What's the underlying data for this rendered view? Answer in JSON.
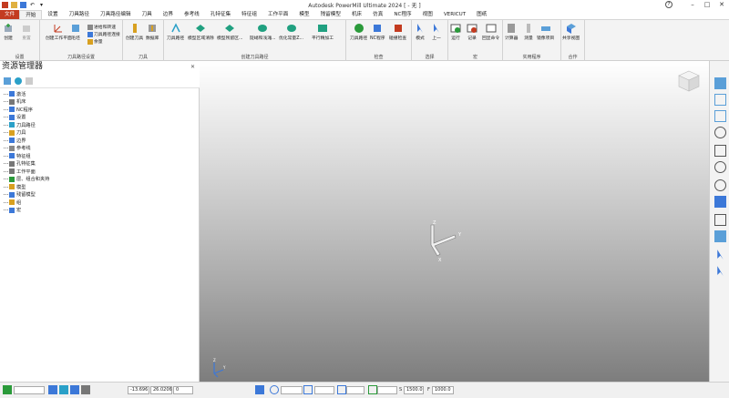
{
  "window": {
    "title": "Autodesk PowerMill Ultimate 2024   [ - 无 ]",
    "help": "?"
  },
  "tabs": [
    {
      "label": "文件",
      "kind": "file"
    },
    {
      "label": "开始",
      "kind": "active"
    },
    {
      "label": "设置",
      "kind": ""
    },
    {
      "label": "刀具路径",
      "kind": ""
    },
    {
      "label": "刀具路径编辑",
      "kind": ""
    },
    {
      "label": "刀具",
      "kind": ""
    },
    {
      "label": "边界",
      "kind": ""
    },
    {
      "label": "参考线",
      "kind": ""
    },
    {
      "label": "孔特征集",
      "kind": ""
    },
    {
      "label": "特征组",
      "kind": ""
    },
    {
      "label": "工作平面",
      "kind": ""
    },
    {
      "label": "模型",
      "kind": ""
    },
    {
      "label": "残留模型",
      "kind": ""
    },
    {
      "label": "机床",
      "kind": ""
    },
    {
      "label": "仿真",
      "kind": ""
    },
    {
      "label": "NC程序",
      "kind": ""
    },
    {
      "label": "视图",
      "kind": ""
    },
    {
      "label": "VERICUT",
      "kind": ""
    },
    {
      "label": "图纸",
      "kind": ""
    }
  ],
  "ribbon": {
    "groups": {
      "setup": "设置",
      "toolpath_setup": "刀具路径设置",
      "tool": "刀具",
      "create_toolpath": "创建刀具路径",
      "check": "检查",
      "select": "选择",
      "macro": "宏",
      "utilities": "实用程序",
      "cooperate": "合作"
    },
    "buttons": {
      "create": "创建",
      "reset": "重置",
      "create_workplane": "创建工作平面",
      "blank": "毛坯",
      "feed_rate": "进给和转速",
      "toolpath_links": "刀具路径连接",
      "allowance": "余量",
      "create_tool": "创建刀具",
      "database": "数据库",
      "toolpath": "刀具路径",
      "model_area_clear": "模型区域清除",
      "model_rest_clear": "模型残留区...",
      "steep_shallow": "陡峭和浅滩...",
      "optimized_constant_z": "优化常量Z...",
      "flat_finish": "平行精加工",
      "toolpath_check": "刀具路径",
      "nc_program": "NC程序",
      "collision_check": "碰撞检查",
      "mode": "模式",
      "previous": "上一",
      "run": "运行",
      "record": "记录",
      "echo_command": "回显命令",
      "calculator": "计算器",
      "measure": "测量",
      "mirror_project": "镜像项目",
      "share_view": "共享视图"
    }
  },
  "explorer": {
    "title": "资源管理器",
    "items": [
      {
        "label": "激活",
        "color": "#3c78d8"
      },
      {
        "label": "机床",
        "color": "#777777"
      },
      {
        "label": "NC程序",
        "color": "#3c78d8"
      },
      {
        "label": "设置",
        "color": "#3c78d8"
      },
      {
        "label": "刀具路径",
        "color": "#2aa0c8"
      },
      {
        "label": "刀具",
        "color": "#d8a020"
      },
      {
        "label": "边界",
        "color": "#3c78d8"
      },
      {
        "label": "参考线",
        "color": "#888888"
      },
      {
        "label": "特征组",
        "color": "#3c78d8"
      },
      {
        "label": "孔特征集",
        "color": "#777777"
      },
      {
        "label": "工作平面",
        "color": "#777777"
      },
      {
        "label": "层、组合和夹持",
        "color": "#2a9a3a"
      },
      {
        "label": "模型",
        "color": "#d8a020"
      },
      {
        "label": "残留模型",
        "color": "#3c78d8"
      },
      {
        "label": "组",
        "color": "#d8a020"
      },
      {
        "label": "宏",
        "color": "#3c78d8"
      }
    ]
  },
  "axes": {
    "x": "X",
    "y": "Y",
    "z": "Z"
  },
  "status": {
    "coord_x": "-13.696",
    "coord_y": "26.0206",
    "coord_z": "0",
    "s_label": "S",
    "s_value": "1500.0",
    "f_label": "F",
    "f_value": "1000.0"
  },
  "colors": {
    "accent": "#c33b20",
    "selected_tool": "#3c78d8",
    "ribbon_bg": "#f3f3f3"
  }
}
